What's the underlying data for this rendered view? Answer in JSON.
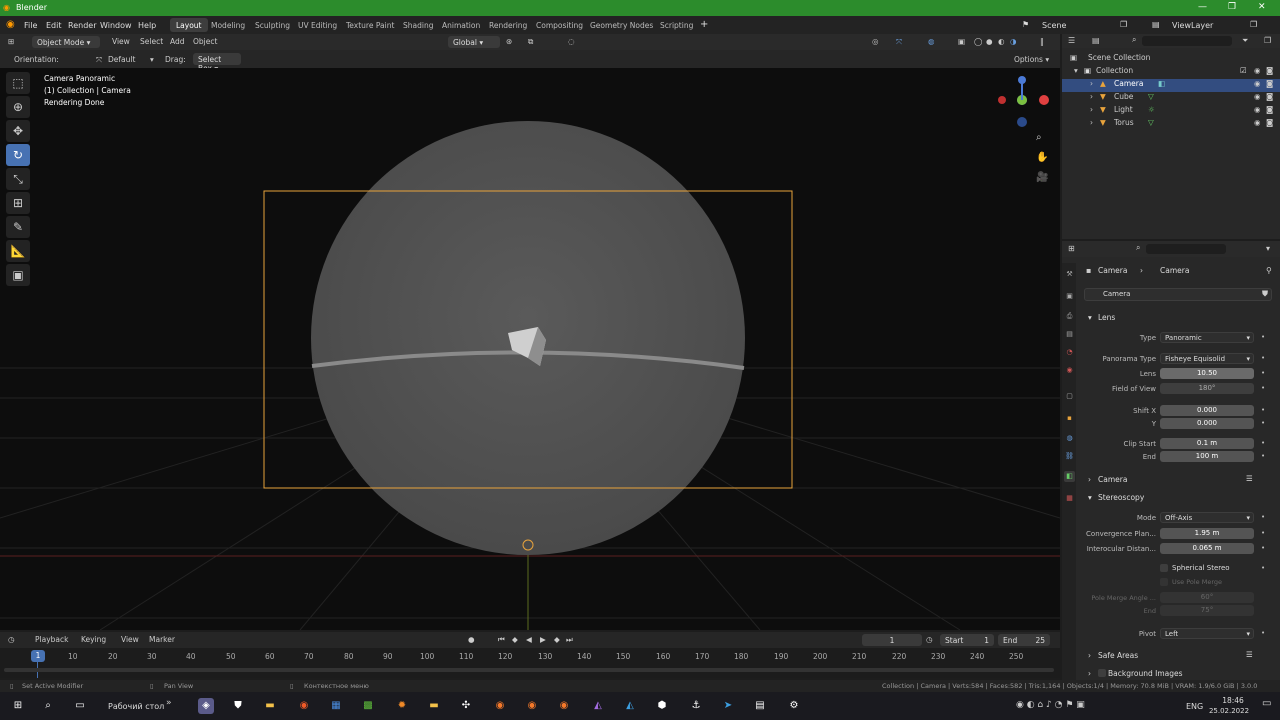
{
  "titlebar": {
    "title": "Blender"
  },
  "menu": [
    "File",
    "Edit",
    "Render",
    "Window",
    "Help"
  ],
  "workspaces": [
    "Layout",
    "Modeling",
    "Sculpting",
    "UV Editing",
    "Texture Paint",
    "Shading",
    "Animation",
    "Rendering",
    "Compositing",
    "Geometry Nodes",
    "Scripting"
  ],
  "scene": {
    "name": "Scene",
    "view_layer": "ViewLayer"
  },
  "vpheader": {
    "mode": "Object Mode",
    "view": "View",
    "select": "Select",
    "add": "Add",
    "object": "Object",
    "transform": "Global"
  },
  "toolheader": {
    "orientation_label": "Orientation:",
    "orientation_value": "Default",
    "drag_label": "Drag:",
    "drag_value": "Select Box",
    "options": "Options"
  },
  "viewport": {
    "line1": "Camera Panoramic",
    "line2": "(1) Collection | Camera",
    "line3": "Rendering Done"
  },
  "outliner": {
    "scene_collection": "Scene Collection",
    "collection": "Collection",
    "items": [
      "Camera",
      "Cube",
      "Light",
      "Torus"
    ]
  },
  "props": {
    "breadcrumb1": "Camera",
    "breadcrumb2": "Camera",
    "datablock": "Camera",
    "lens_section": "Lens",
    "type_label": "Type",
    "type_value": "Panoramic",
    "ptype_label": "Panorama Type",
    "ptype_value": "Fisheye Equisolid",
    "lens_label": "Lens",
    "lens_value": "10.50",
    "fov_label": "Field of View",
    "fov_value": "180°",
    "shiftx_label": "Shift X",
    "shiftx_value": "0.000",
    "shifty_label": "Y",
    "shifty_value": "0.000",
    "clipstart_label": "Clip Start",
    "clipstart_value": "0.1 m",
    "clipend_label": "End",
    "clipend_value": "100 m",
    "camera_section": "Camera",
    "stereo_section": "Stereoscopy",
    "mode_label": "Mode",
    "mode_value": "Off-Axis",
    "conv_label": "Convergence Plan...",
    "conv_value": "1.95 m",
    "inter_label": "Interocular Distan...",
    "inter_value": "0.065 m",
    "spherical": "Spherical Stereo",
    "polemerge": "Use Pole Merge",
    "polemerge_angle_label": "Pole Merge Angle ...",
    "polemerge_angle_value": "60°",
    "polemerge_end_label": "End",
    "polemerge_end_value": "75°",
    "pivot_label": "Pivot",
    "pivot_value": "Left",
    "safe_areas": "Safe Areas",
    "bg_images": "Background Images"
  },
  "timeline": {
    "playback": "Playback",
    "keying": "Keying",
    "view": "View",
    "marker": "Marker",
    "current_frame": "1",
    "start_label": "Start",
    "start": "1",
    "end_label": "End",
    "end": "25",
    "ticks": [
      "10",
      "20",
      "30",
      "40",
      "50",
      "60",
      "70",
      "80",
      "90",
      "100",
      "110",
      "120",
      "130",
      "140",
      "150",
      "160",
      "170",
      "180",
      "190",
      "200",
      "210",
      "220",
      "230",
      "240",
      "250"
    ],
    "playhead": "1"
  },
  "status": {
    "left": "Set Active Modifier",
    "middle": "Pan View",
    "context": "Контекстное меню",
    "right": "Collection | Camera | Verts:584 | Faces:582 | Tris:1,164 | Objects:1/4 | Memory: 70.8 MiB | VRAM: 1.9/6.0 GiB | 3.0.0"
  },
  "taskbar": {
    "desktop": "Рабочий стол",
    "lang": "ENG",
    "time": "18:46",
    "date": "25.02.2022"
  },
  "colors": {
    "accent": "#4772b3",
    "titlebar": "#2c8c2c",
    "camera_frame": "#e8a33c"
  }
}
